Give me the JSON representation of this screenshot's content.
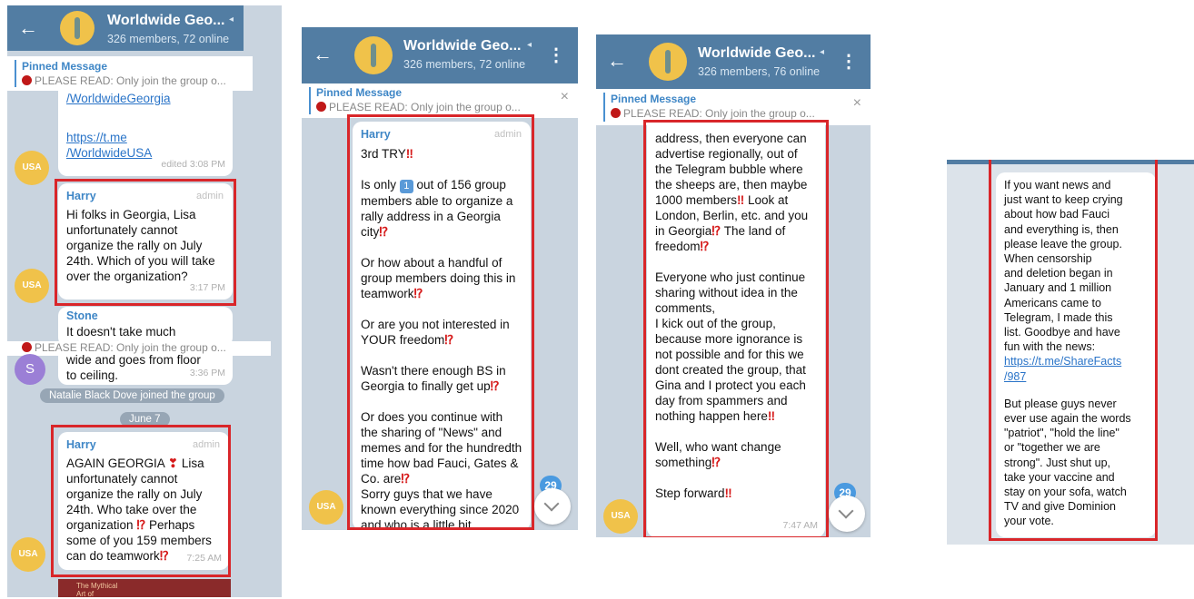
{
  "chat": {
    "title": "Worldwide Geo...",
    "subtitle_72": "326 members, 72 online",
    "subtitle_76": "326 members, 76 online",
    "pinned_label": "Pinned Message",
    "pinned_text": "PLEASE READ:  Only join the group o..."
  },
  "panel1": {
    "link1": "/WorldwideGeorgia",
    "link2": "https://t.me\n/WorldwideUSA",
    "edited": "edited 3:08 PM",
    "msg1": {
      "sender": "Harry",
      "role": "admin",
      "text": "Hi folks in Georgia, Lisa unfortunately cannot organize the rally on July 24th. Which of you will take over the organization?",
      "time": "3:17 PM"
    },
    "stone_sender": "Stone",
    "stone_text": "It doesn't take much",
    "stone_tail": "wide and goes from floor\nto ceiling.",
    "stone_time": "3:36 PM",
    "stone_avatar": "S",
    "join_notice": "Natalie Black Dove joined the group",
    "date_chip": "June 7",
    "msg2": {
      "sender": "Harry",
      "role": "admin",
      "line1": "AGAIN GEORGIA",
      "text_after": " Lisa unfortunately cannot organize the rally on July 24th. Who take over the organization",
      "line3": " Perhaps some of you 159 members can do teamwork",
      "time": "7:25 AM"
    },
    "thumb_text": "The Mythical\nArt of"
  },
  "panel2": {
    "sender": "Harry",
    "role": "admin",
    "p1": "3rd TRY",
    "p2a": "Is only ",
    "p2_key": "1",
    "p2b": " out of 156 group members able to organize a rally address in a Georgia city",
    "p3": "Or how about a handful of group members doing this in teamwork",
    "p4": "Or are you not interested in YOUR freedom",
    "p5": "Wasn't there enough BS in Georgia to finally get up",
    "p6": "Or does you continue with the sharing of \"News\" and memes and for the hundredth time how bad Fauci, Gates & Co. are",
    "p7": "Sorry guys that we have known everything since 2020 and who is a little bit",
    "badge": "29"
  },
  "panel3": {
    "p1a": "address, then everyone can advertise regionally, out of the Telegram bubble where the sheeps are, then maybe 1000 members",
    "p1b": " Look at London, Berlin, etc. and you in Georgia",
    "p1c": " The land of freedom",
    "p2": "Everyone who just continue sharing without idea in the comments,\nI kick out of the group, because more ignorance is not possible and for this we dont created the group, that Gina and I protect you each day from spammers and nothing happen here",
    "p3": "Well, who want change something",
    "p4": "Step forward",
    "time": "7:47 AM",
    "badge": "29"
  },
  "panel4": {
    "p1": "If you want news and\njust want to keep crying\nabout how bad Fauci\nand everything is, then\nplease leave the group.\nWhen censorship\nand deletion began in\nJanuary and 1 million\nAmericans came to\nTelegram, I made this\nlist. Goodbye and have\nfun with the news:",
    "link": "https://t.me/ShareFacts\n/987",
    "p2": "But please guys never\never use again the words\n\"patriot\", \"hold the line\"\nor \"together we are\nstrong\". Just shut up,\ntake your vaccine and\nstay on your sofa, watch\nTV and give Dominion\nyour vote."
  },
  "symbols": {
    "excl": "‼",
    "interrobang": "⁉",
    "back": "←",
    "menu": "⋮",
    "close": "×",
    "mute": "◂",
    "usa": "USA"
  },
  "colors": {
    "header": "#527da3",
    "highlight": "#d9262a",
    "link": "#2a74c8",
    "chat_bg": "#c9d4df"
  }
}
